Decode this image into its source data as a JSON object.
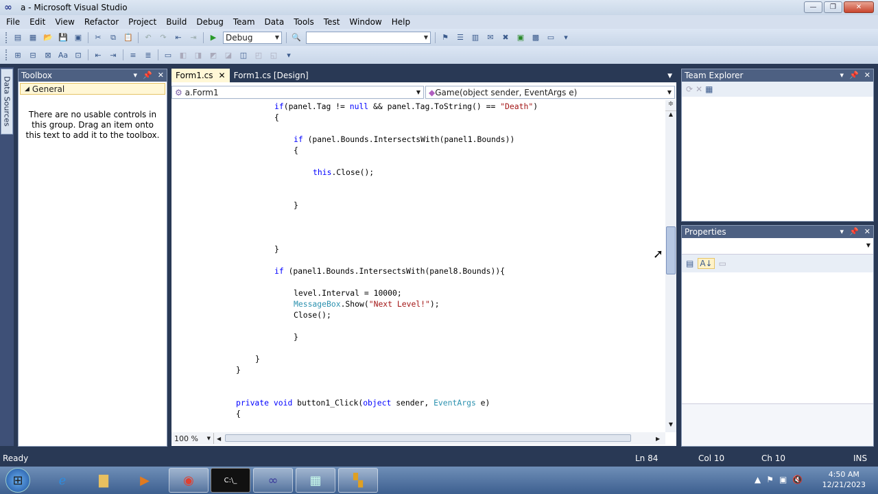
{
  "window": {
    "title": "a - Microsoft Visual Studio"
  },
  "menu": [
    "File",
    "Edit",
    "View",
    "Refactor",
    "Project",
    "Build",
    "Debug",
    "Team",
    "Data",
    "Tools",
    "Test",
    "Window",
    "Help"
  ],
  "toolbar": {
    "config_value": "Debug",
    "platform_value": ""
  },
  "toolbox": {
    "title": "Toolbox",
    "group": "General",
    "empty_text": "There are no usable controls in this group. Drag an item onto this text to add it to the toolbox."
  },
  "left_tab": "Data Sources",
  "editor": {
    "tabs": [
      {
        "label": "Form1.cs",
        "active": true
      },
      {
        "label": "Form1.cs [Design]",
        "active": false
      }
    ],
    "class_combo": "a.Form1",
    "member_combo": "Game(object sender, EventArgs e)",
    "zoom": "100 %",
    "lines": [
      {
        "indent": 4,
        "tokens": [
          [
            "kw",
            "if"
          ],
          [
            "",
            "(panel.Tag != "
          ],
          [
            "kw",
            "null"
          ],
          [
            "",
            " && panel.Tag.ToString() == "
          ],
          [
            "str",
            "\"Death\""
          ],
          [
            "",
            ")"
          ]
        ]
      },
      {
        "indent": 4,
        "tokens": [
          [
            "",
            "{"
          ]
        ]
      },
      {
        "indent": 0,
        "tokens": []
      },
      {
        "indent": 5,
        "tokens": [
          [
            "kw",
            "if"
          ],
          [
            "",
            " (panel.Bounds.IntersectsWith(panel1.Bounds))"
          ]
        ]
      },
      {
        "indent": 5,
        "tokens": [
          [
            "",
            "{"
          ]
        ]
      },
      {
        "indent": 0,
        "tokens": []
      },
      {
        "indent": 6,
        "tokens": [
          [
            "kw",
            "this"
          ],
          [
            "",
            ".Close();"
          ]
        ]
      },
      {
        "indent": 0,
        "tokens": []
      },
      {
        "indent": 0,
        "tokens": []
      },
      {
        "indent": 5,
        "tokens": [
          [
            "",
            "}"
          ]
        ]
      },
      {
        "indent": 0,
        "tokens": []
      },
      {
        "indent": 0,
        "tokens": []
      },
      {
        "indent": 0,
        "tokens": []
      },
      {
        "indent": 4,
        "tokens": [
          [
            "",
            "}"
          ]
        ]
      },
      {
        "indent": 0,
        "tokens": []
      },
      {
        "indent": 4,
        "tokens": [
          [
            "kw",
            "if"
          ],
          [
            "",
            " (panel1.Bounds.IntersectsWith(panel8.Bounds)){"
          ]
        ]
      },
      {
        "indent": 0,
        "tokens": []
      },
      {
        "indent": 5,
        "tokens": [
          [
            "",
            "level.Interval = 10000;"
          ]
        ]
      },
      {
        "indent": 5,
        "tokens": [
          [
            "typ",
            "MessageBox"
          ],
          [
            "",
            ".Show("
          ],
          [
            "str",
            "\"Next Level!\""
          ],
          [
            "",
            ");"
          ]
        ]
      },
      {
        "indent": 5,
        "tokens": [
          [
            "",
            "Close();"
          ]
        ]
      },
      {
        "indent": 0,
        "tokens": []
      },
      {
        "indent": 5,
        "tokens": [
          [
            "",
            "}"
          ]
        ]
      },
      {
        "indent": 0,
        "tokens": []
      },
      {
        "indent": 3,
        "tokens": [
          [
            "",
            "}"
          ]
        ]
      },
      {
        "indent": 2,
        "tokens": [
          [
            "",
            "}"
          ]
        ]
      },
      {
        "indent": 0,
        "tokens": []
      },
      {
        "indent": 0,
        "tokens": []
      },
      {
        "indent": 2,
        "tokens": [
          [
            "kw",
            "private"
          ],
          [
            "kw",
            " void"
          ],
          [
            "",
            " button1_Click("
          ],
          [
            "kw",
            "object"
          ],
          [
            "",
            " sender, "
          ],
          [
            "typ",
            "EventArgs"
          ],
          [
            "",
            " e)"
          ]
        ]
      },
      {
        "indent": 2,
        "tokens": [
          [
            "",
            "{"
          ]
        ]
      }
    ]
  },
  "team_explorer": {
    "title": "Team Explorer"
  },
  "properties": {
    "title": "Properties"
  },
  "status": {
    "left": "Ready",
    "ln": "Ln 84",
    "col": "Col 10",
    "ch": "Ch 10",
    "mode": "INS"
  },
  "clock": {
    "time": "4:50 AM",
    "date": "12/21/2023"
  },
  "colors": {
    "keyword": "#0000ff",
    "string": "#a31515",
    "type": "#2b91af",
    "chrome": "#293955"
  }
}
